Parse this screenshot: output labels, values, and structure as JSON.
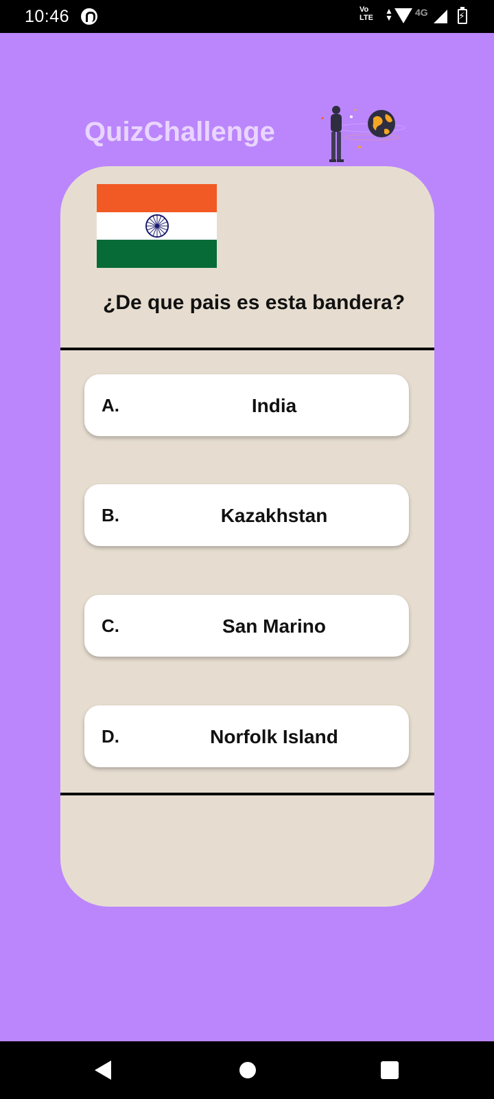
{
  "status_bar": {
    "time": "10:46",
    "network_label": "Vo\nLTE",
    "network_type": "4G",
    "icons": [
      "app-notification-icon",
      "data-arrows-icon",
      "wifi-icon",
      "signal-icon",
      "battery-charging-icon"
    ]
  },
  "header": {
    "title": "QuizChallenge",
    "illustration": "person-with-globe-illustration"
  },
  "quiz": {
    "flag": "india-flag",
    "flag_colors": [
      "#f15a24",
      "#ffffff",
      "#076b37"
    ],
    "chakra_color": "#1a1a6e",
    "question": "¿De que pais es esta bandera?",
    "answers": [
      {
        "letter": "A.",
        "text": "India"
      },
      {
        "letter": "B.",
        "text": "Kazakhstan"
      },
      {
        "letter": "C.",
        "text": "San Marino"
      },
      {
        "letter": "D.",
        "text": "Norfolk Island"
      }
    ]
  },
  "colors": {
    "background": "#bb86fc",
    "card": "#e6ddd0",
    "title": "#e9d5ff",
    "answer_bg": "#ffffff"
  },
  "nav_bar": {
    "icons": [
      "back-icon",
      "home-icon",
      "recents-icon"
    ]
  }
}
